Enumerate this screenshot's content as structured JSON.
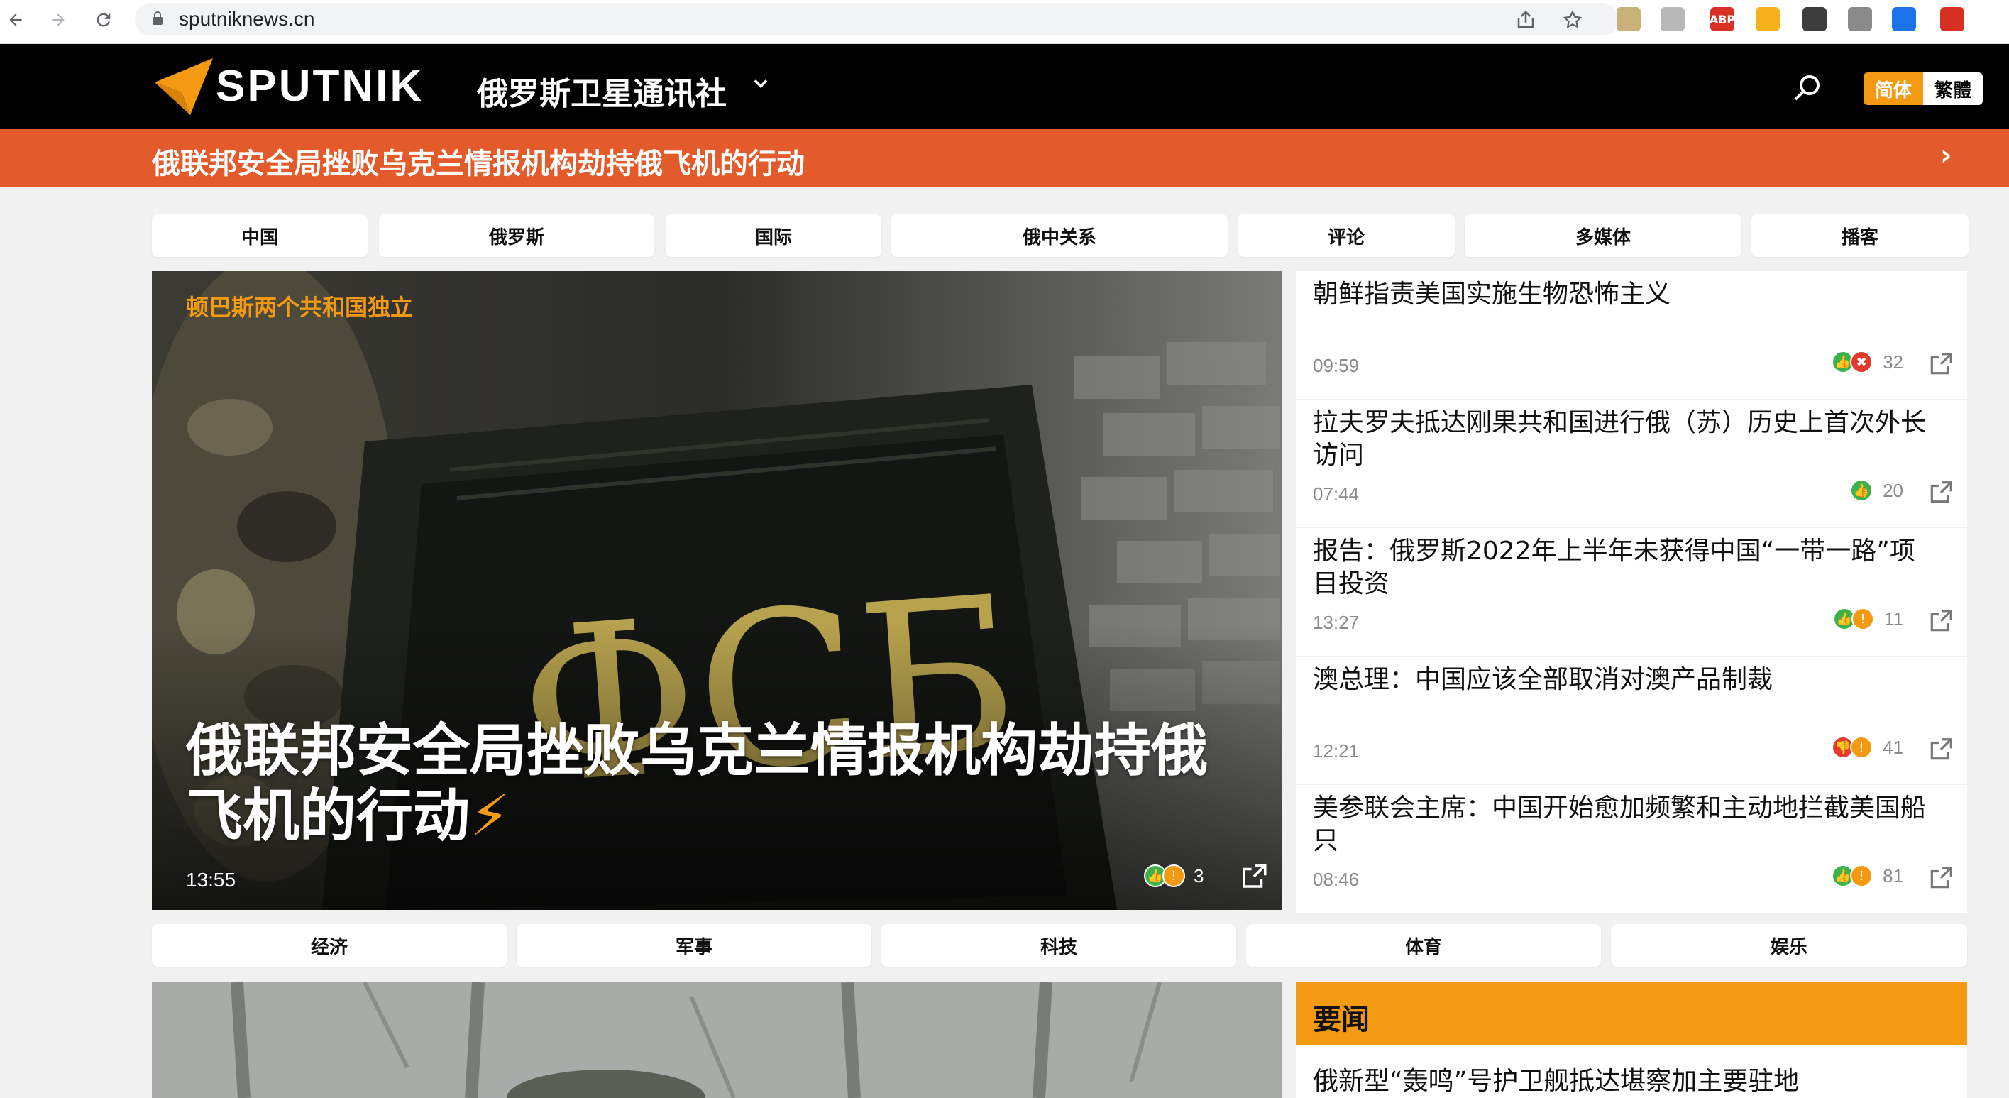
{
  "browser": {
    "url": "sputniknews.cn",
    "back_icon": "arrow-left-icon",
    "forward_icon": "arrow-right-icon",
    "reload_icon": "reload-icon",
    "extensions": [
      {
        "name": "image-extension-icon",
        "color": "#c9b27a",
        "label": ""
      },
      {
        "name": "grayscale-extension-icon",
        "color": "#b8b8b8",
        "label": ""
      },
      {
        "name": "adblock-extension-icon",
        "color": "#d93025",
        "label": "ABP"
      },
      {
        "name": "notes-extension-icon",
        "color": "#f6b21a",
        "label": ""
      },
      {
        "name": "dots-extension-icon",
        "color": "#3c3c3c",
        "label": ""
      },
      {
        "name": "camera-extension-icon",
        "color": "#8a8a8a",
        "label": ""
      },
      {
        "name": "play-extension-icon",
        "color": "#1a73e8",
        "label": ""
      },
      {
        "name": "translate-extension-icon",
        "color": "#d93025",
        "label": ""
      }
    ]
  },
  "header": {
    "logo_text": "SPUTNIK",
    "site_title": "俄罗斯卫星通讯社",
    "lang_simplified": "简体",
    "lang_traditional": "繁體",
    "accent": "#f39a12"
  },
  "banner": {
    "text": "俄联邦安全局挫败乌克兰情报机构劫持俄飞机的行动",
    "arrow": "›",
    "color": "#e35b2a"
  },
  "nav": {
    "tabs": [
      "中国",
      "俄罗斯",
      "国际",
      "俄中关系",
      "评论",
      "多媒体",
      "播客"
    ]
  },
  "hero": {
    "kicker": "顿巴斯两个共和国独立",
    "title": "俄联邦安全局挫败乌克兰情报机构劫持俄飞机的行动",
    "bolt": "⚡",
    "time": "13:55",
    "reactions": [
      "like",
      "wow"
    ],
    "count": "3"
  },
  "news": [
    {
      "title": "朝鲜指责美国实施生物恐怖主义",
      "time": "09:59",
      "reactions": [
        "like",
        "angry"
      ],
      "count": "32"
    },
    {
      "title": "拉夫罗夫抵达刚果共和国进行俄（苏）历史上首次外长访问",
      "time": "07:44",
      "reactions": [
        "like"
      ],
      "count": "20"
    },
    {
      "title": "报告：俄罗斯2022年上半年未获得中国“一带一路”项目投资",
      "time": "13:27",
      "reactions": [
        "like",
        "wow"
      ],
      "count": "11"
    },
    {
      "title": "澳总理：中国应该全部取消对澳产品制裁",
      "time": "12:21",
      "reactions": [
        "dislike",
        "wow"
      ],
      "count": "41"
    },
    {
      "title": "美参联会主席：中国开始愈加频繁和主动地拦截美国船只",
      "time": "08:46",
      "reactions": [
        "like",
        "wow"
      ],
      "count": "81"
    }
  ],
  "nav2": {
    "tabs": [
      "经济",
      "军事",
      "科技",
      "体育",
      "娱乐"
    ]
  },
  "yaowen": {
    "label": "要闻",
    "first_item": "俄新型“轰鸣”号护卫舰抵达堪察加主要驻地"
  }
}
